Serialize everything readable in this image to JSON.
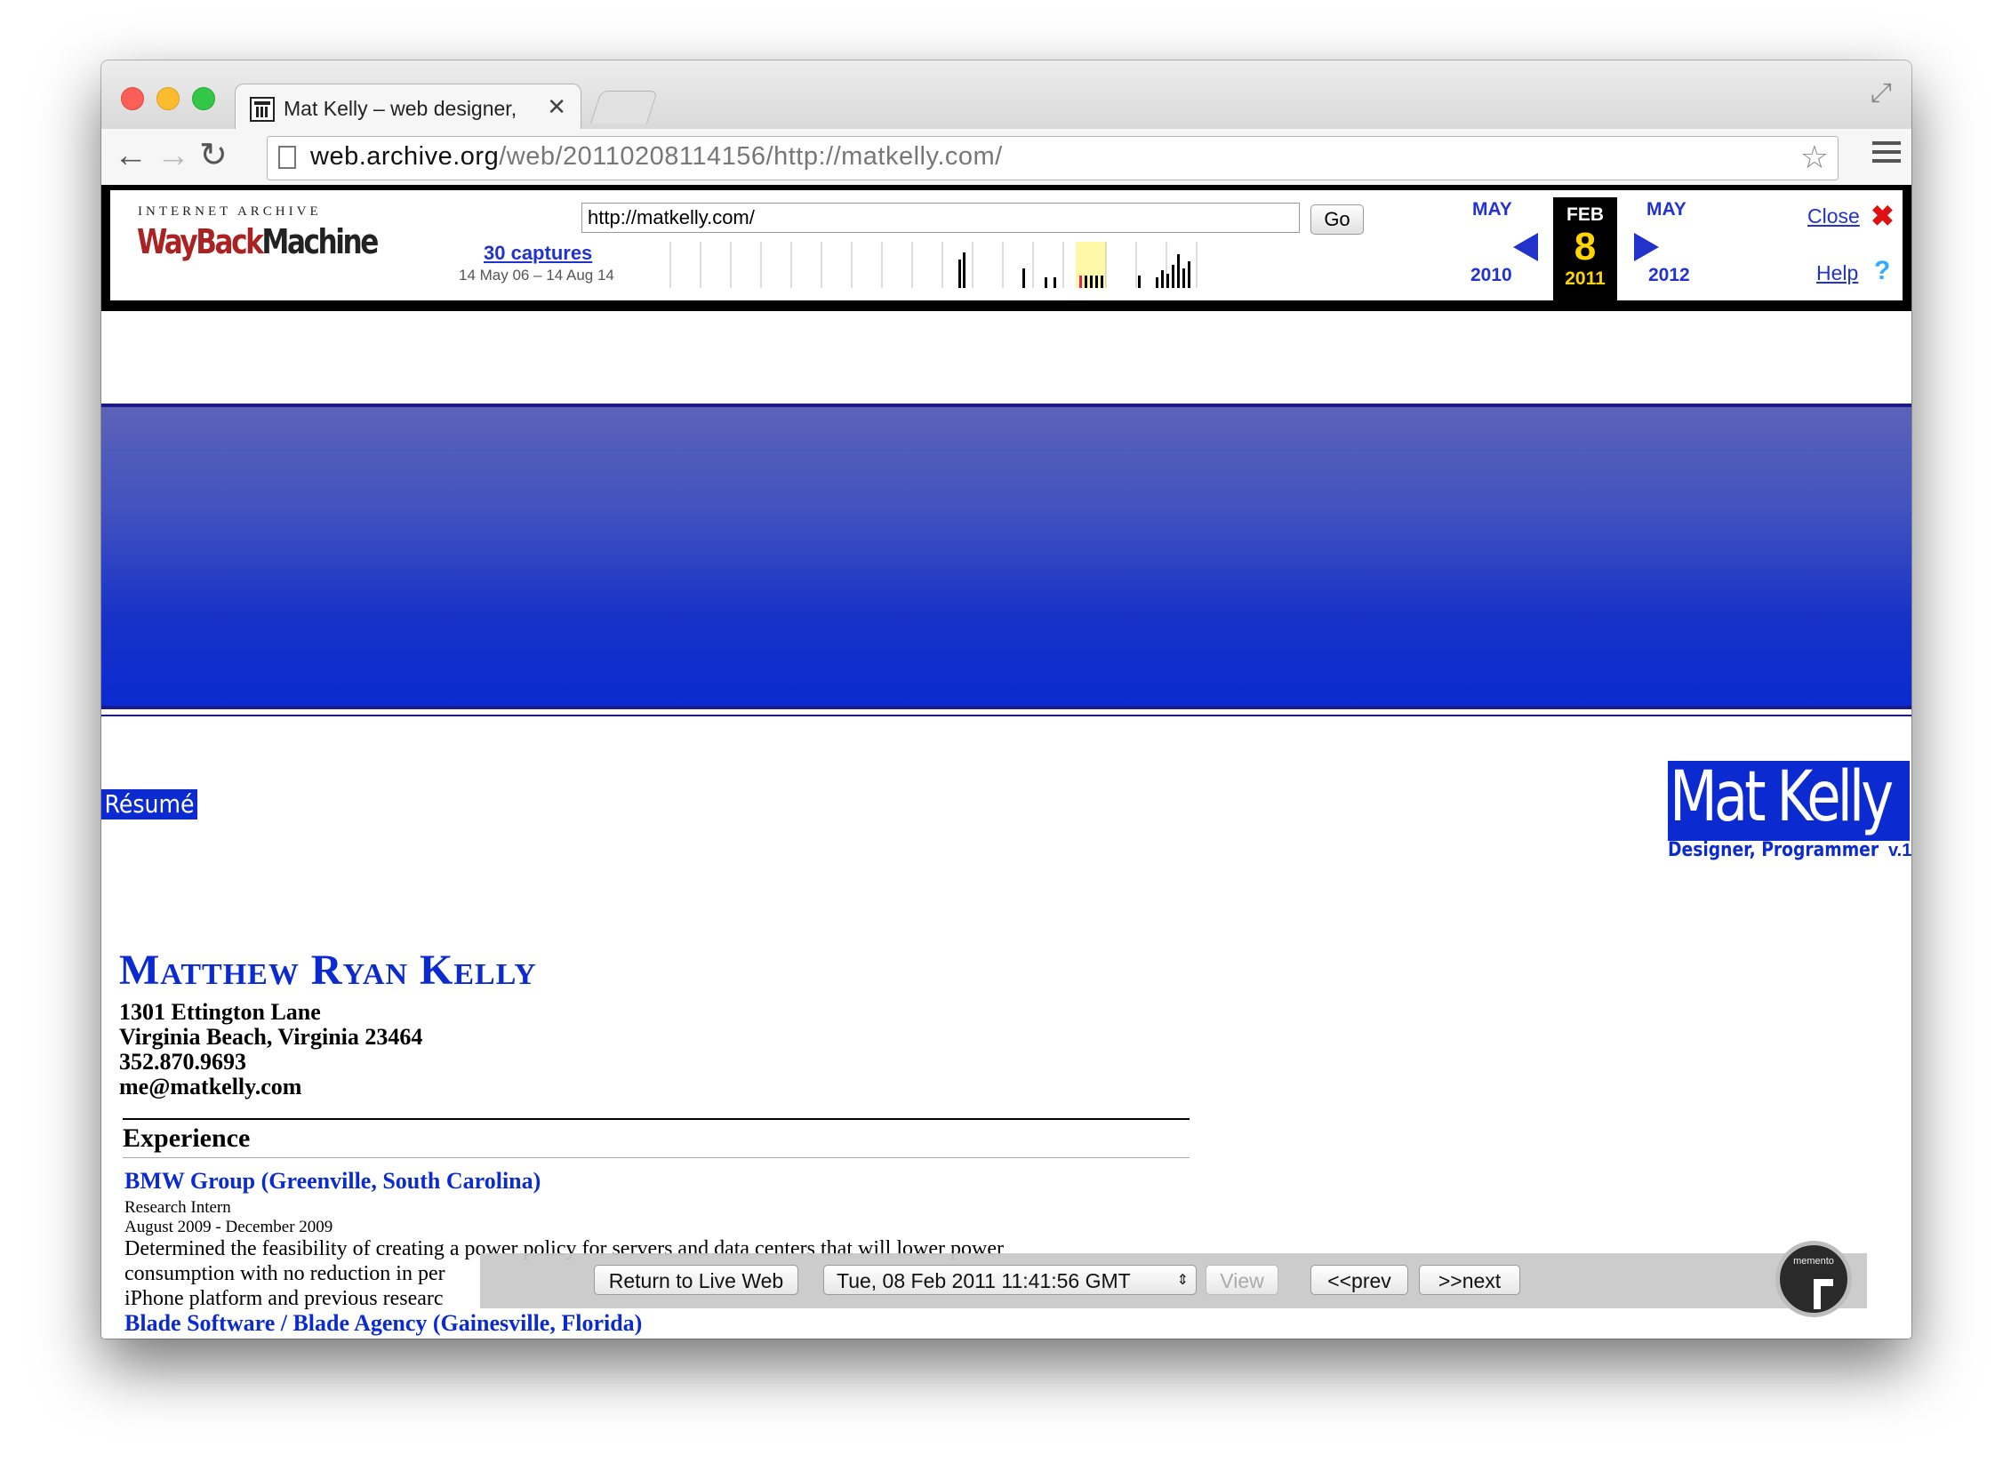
{
  "browser": {
    "tab_title": "Mat Kelly – web designer, p",
    "url_host": "web.archive.org",
    "url_path": "/web/20110208114156/http://matkelly.com/"
  },
  "wayback": {
    "logo_top": "INTERNET ARCHIVE",
    "logo_wayback": "WayBack",
    "logo_machine": "Machine",
    "url_value": "http://matkelly.com/",
    "go_label": "Go",
    "captures": "30 captures",
    "range": "14 May 06 – 14 Aug 14",
    "prev_month": "MAY",
    "prev_year": "2010",
    "cur_month": "FEB",
    "cur_day": "8",
    "cur_year": "2011",
    "next_month": "MAY",
    "next_year": "2012",
    "close_label": "Close",
    "close_icon": "✖",
    "help_label": "Help",
    "help_icon": "?"
  },
  "page": {
    "resume_tab": "Résumé",
    "logo_name": "Mat Kelly",
    "logo_sub": "Designer, Programmer",
    "logo_ver": "v.1",
    "name": "Matthew Ryan Kelly",
    "address": [
      "1301 Ettington Lane",
      "Virginia Beach, Virginia 23464",
      "352.870.9693",
      "me@matkelly.com"
    ],
    "experience_heading": "Experience",
    "job1_title": "BMW Group (Greenville, South Carolina)",
    "job1_role": "Research Intern",
    "job1_dates": "August 2009 - December 2009",
    "job1_desc": [
      "Determined the feasibility of creating a power policy for servers and data centers that will lower power",
      "consumption with no reduction in per",
      "iPhone platform and previous researc"
    ],
    "job2_title": "Blade Software / Blade Agency (Gainesville, Florida)"
  },
  "memento": {
    "return_label": "Return to Live Web",
    "datetime": "Tue, 08 Feb 2011 11:41:56 GMT",
    "view_label": "View",
    "prev_label": "<<prev",
    "next_label": ">>next",
    "clock_label": "memento"
  }
}
